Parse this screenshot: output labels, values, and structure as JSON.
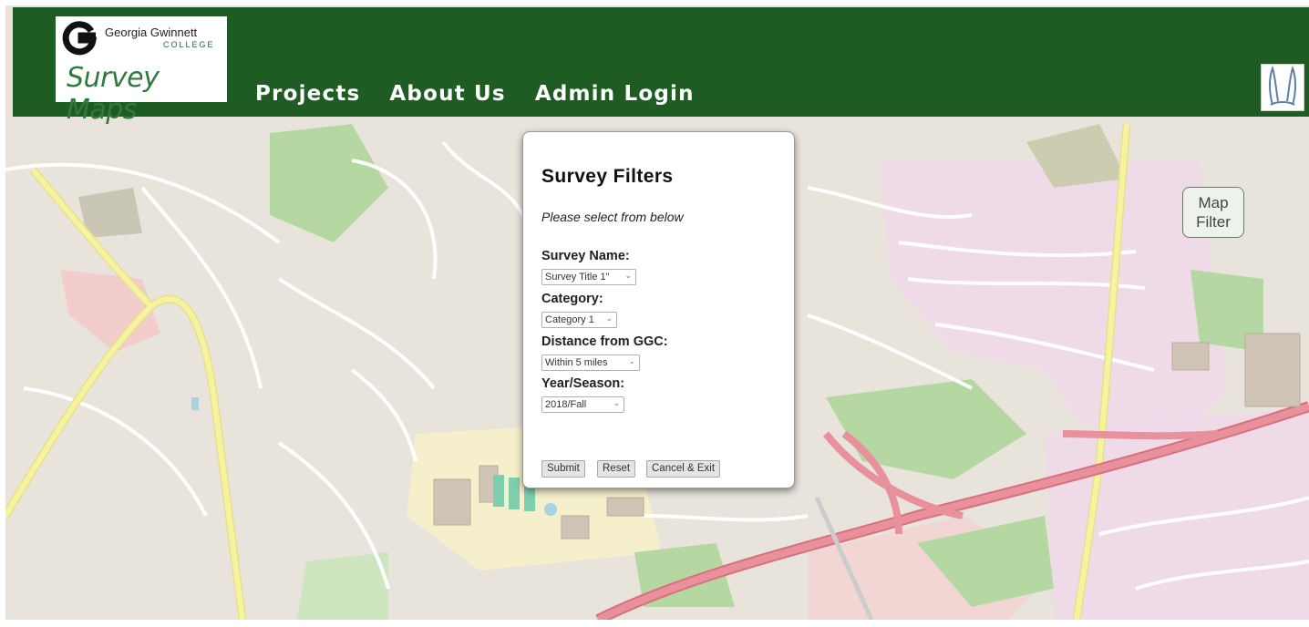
{
  "branding": {
    "college_name": "Georgia Gwinnett",
    "college_sub": "COLLEGE",
    "app_name": "Survey Maps"
  },
  "nav": {
    "items": [
      {
        "label": "Projects"
      },
      {
        "label": "About Us"
      },
      {
        "label": "Admin Login"
      }
    ]
  },
  "map_filter": {
    "line1": "Map",
    "line2": "Filter"
  },
  "modal": {
    "title": "Survey Filters",
    "subtitle": "Please select from below",
    "fields": [
      {
        "label": "Survey Name:",
        "value": "Survey Title 1\""
      },
      {
        "label": "Category:",
        "value": "Category 1"
      },
      {
        "label": "Distance from GGC:",
        "value": "Within 5 miles"
      },
      {
        "label": "Year/Season:",
        "value": "2018/Fall"
      }
    ],
    "buttons": {
      "submit": "Submit",
      "reset": "Reset",
      "cancel": "Cancel & Exit"
    }
  },
  "colors": {
    "header": "#1f5c24",
    "map_land": "#e8e4dc",
    "park": "#b5d8a3",
    "highway": "#e8909c",
    "major_road": "#f6f3a0",
    "commercial": "#f0d8ea"
  },
  "icons": {
    "logo": "ggc-g-logo",
    "mascot": "grizzly-mascot-icon",
    "select_arrow": "chevron-down-icon"
  }
}
